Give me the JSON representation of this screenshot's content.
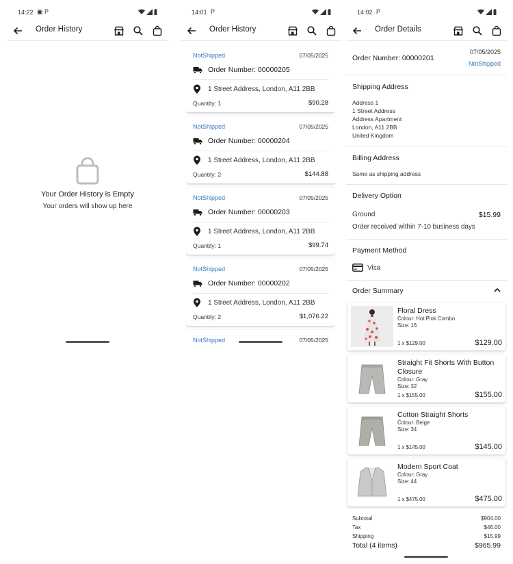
{
  "screen1": {
    "status": {
      "time": "14:22",
      "extra": "▣ P"
    },
    "appbar": {
      "title": "Order History"
    },
    "empty": {
      "title": "Your Order History is Empty",
      "subtitle": "Your orders will show up here"
    }
  },
  "screen2": {
    "status": {
      "time": "14:01",
      "extra": "P"
    },
    "appbar": {
      "title": "Order History"
    },
    "orders": [
      {
        "status": "NotShipped",
        "date": "07/05/2025",
        "number_label": "Order Number: 00000205",
        "address": "1 Street Address, London, A11 2BB",
        "quantity": "Quantity: 1",
        "total": "$90.28"
      },
      {
        "status": "NotShipped",
        "date": "07/05/2025",
        "number_label": "Order Number: 00000204",
        "address": "1 Street Address, London, A11 2BB",
        "quantity": "Quantity: 2",
        "total": "$144.88"
      },
      {
        "status": "NotShipped",
        "date": "07/05/2025",
        "number_label": "Order Number: 00000203",
        "address": "1 Street Address, London, A11 2BB",
        "quantity": "Quantity: 1",
        "total": "$99.74"
      },
      {
        "status": "NotShipped",
        "date": "07/05/2025",
        "number_label": "Order Number: 00000202",
        "address": "1 Street Address, London, A11 2BB",
        "quantity": "Quantity: 2",
        "total": "$1,076.22"
      },
      {
        "status": "NotShipped",
        "date": "07/05/2025"
      }
    ]
  },
  "screen3": {
    "status": {
      "time": "14:02",
      "extra": "P"
    },
    "appbar": {
      "title": "Order Details"
    },
    "order": {
      "number_label": "Order Number: 00000201",
      "date": "07/05/2025",
      "status": "NotShipped"
    },
    "shipping": {
      "heading": "Shipping Address",
      "lines": [
        "Address 1",
        "1 Street Address",
        "Address Apartment",
        "London, A11 2BB",
        "United Kingdom"
      ]
    },
    "billing": {
      "heading": "Billing Address",
      "text": "Same as shipping address"
    },
    "delivery": {
      "heading": "Delivery Option",
      "name": "Ground",
      "price": "$15.99",
      "note": "Order received within 7-10 business days"
    },
    "payment": {
      "heading": "Payment Method",
      "method": "Visa"
    },
    "summary_heading": "Order Summary",
    "products": [
      {
        "name": "Floral Dress",
        "colour": "Colour: Hot Pink Combo",
        "size": "Size: 16",
        "unit": "1 x $129.00",
        "price": "$129.00"
      },
      {
        "name": "Straight Fit Shorts With Button Closure",
        "colour": "Colour: Gray",
        "size": "Size: 32",
        "unit": "1 x $155.00",
        "price": "$155.00"
      },
      {
        "name": "Cotton Straight Shorts",
        "colour": "Colour: Beige",
        "size": "Size: 34",
        "unit": "1 x $145.00",
        "price": "$145.00"
      },
      {
        "name": "Modern Sport Coat",
        "colour": "Colour: Gray",
        "size": "Size: 44",
        "unit": "1 x $475.00",
        "price": "$475.00"
      }
    ],
    "totals": {
      "subtotal_label": "Subtotal",
      "subtotal": "$904.00",
      "tax_label": "Tax",
      "tax": "$46.00",
      "shipping_label": "Shipping",
      "shipping": "$15.99",
      "total_label": "Total (4 items)",
      "total": "$965.99"
    }
  },
  "colors": {
    "accent": "#3a78c3",
    "text": "#1c1c1c",
    "divider": "#e6e6e6"
  },
  "icons": [
    "back-arrow-icon",
    "store-icon",
    "search-icon",
    "shopping-bag-icon",
    "truck-icon",
    "location-pin-icon",
    "credit-card-icon",
    "chevron-up-icon"
  ]
}
